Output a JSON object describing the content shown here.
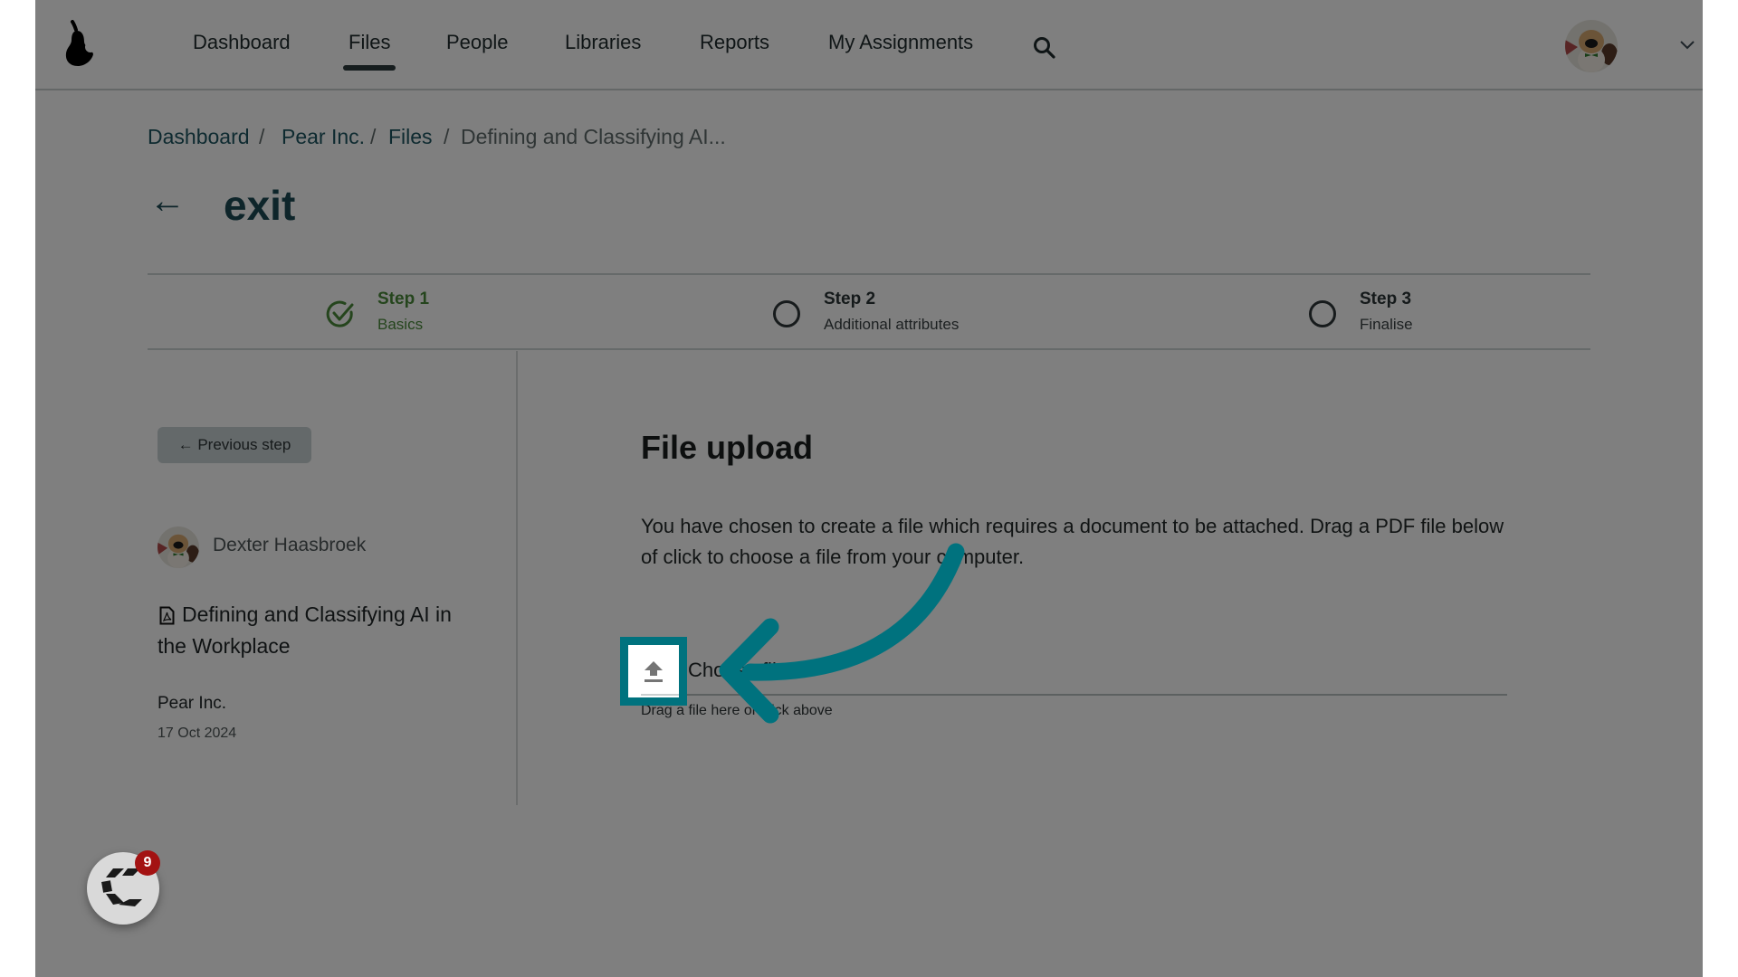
{
  "header": {
    "logo": "pear-logo",
    "nav": [
      {
        "label": "Dashboard",
        "active": false
      },
      {
        "label": "Files",
        "active": true
      },
      {
        "label": "People",
        "active": false
      },
      {
        "label": "Libraries",
        "active": false
      },
      {
        "label": "Reports",
        "active": false
      },
      {
        "label": "My Assignments",
        "active": false
      }
    ],
    "search_icon": "search-icon",
    "user_menu_icon": "chevron-down-icon"
  },
  "breadcrumb": {
    "items": [
      "Dashboard",
      "Pear Inc.",
      "Files",
      "Defining and Classifying AI..."
    ],
    "separator": "/"
  },
  "page": {
    "back_arrow": "←",
    "title": "exit"
  },
  "stepper": {
    "steps": [
      {
        "title": "Step 1",
        "subtitle": "Basics",
        "status": "complete"
      },
      {
        "title": "Step 2",
        "subtitle": "Additional attributes",
        "status": "pending"
      },
      {
        "title": "Step 3",
        "subtitle": "Finalise",
        "status": "pending"
      }
    ],
    "complete_color": "#4a8a3a"
  },
  "sidebar": {
    "previous_step_label": "← Previous step",
    "author_name": "Dexter Haasbroek",
    "file_title": "Defining and Classifying AI in the Workplace",
    "file_icon": "pdf-file-icon",
    "organisation": "Pear Inc.",
    "date": "17 Oct 2024"
  },
  "main": {
    "heading": "File upload",
    "description": "You have chosen to create a file which requires a document to be attached. Drag a PDF file below of click to choose a file from your computer.",
    "choose_file_label": "Choose file",
    "drag_hint": "Drag a file here or click above",
    "upload_icon": "upload-icon"
  },
  "annotation": {
    "color": "#00727e",
    "target": "upload-button"
  },
  "chat_widget": {
    "badge_count": "9",
    "badge_color": "#a31212"
  }
}
